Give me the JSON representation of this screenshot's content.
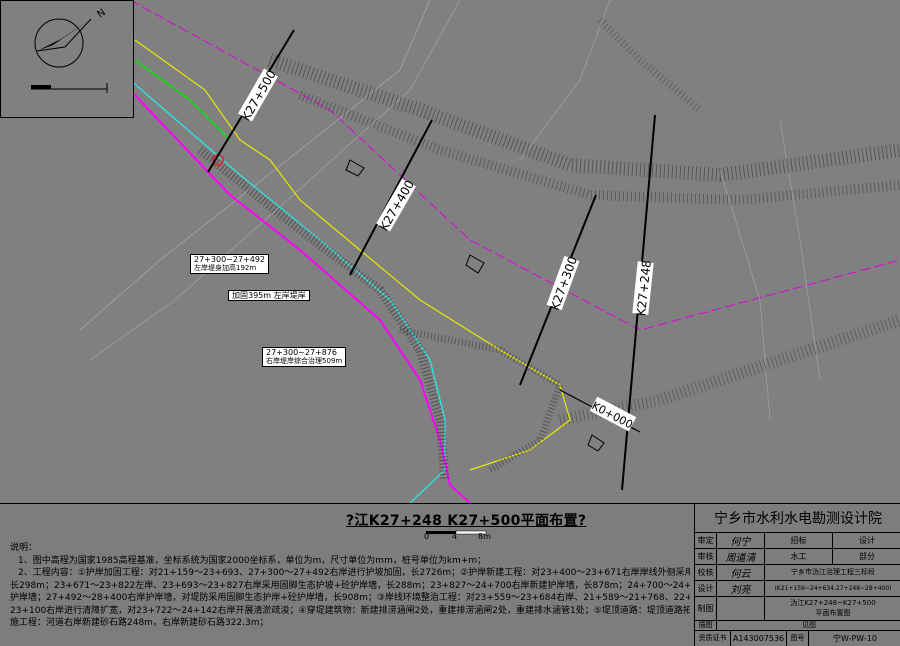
{
  "drawing": {
    "station_labels": [
      "K27+500",
      "K27+400",
      "K27+300",
      "K27+248",
      "K0+000"
    ],
    "callouts": [
      {
        "range": "27+300~27+492",
        "desc": "左岸堤身加高192m"
      },
      {
        "range": "",
        "desc": "加固395m 左岸堤岸"
      },
      {
        "range": "27+300~27+876",
        "desc": "右岸堤岸综合治理509m"
      }
    ]
  },
  "legend": {
    "title": "?江K27+248 K27+500平面布置?",
    "scale_ticks": [
      "0",
      "4",
      "8m"
    ]
  },
  "notes": {
    "heading": "说明：",
    "lines": [
      "1、图中高程为国家1985高程基准，坐标系统为国家2000坐标系，单位为m，尺寸单位为mm，桩号单位为km+m；",
      "2、工程内容：①护岸加固工程：对21+159～23+693、27+300～27+492右岸进行护坡加固，长2726m；②护岸新建工程：对23+400～23+671右岸岸线外侧采用固脚生态护岸+砼护岸墙，",
      "长298m；23+671～23+822左岸、23+693～23+827右岸采用固脚生态护坡+砼护岸墙，长288m；23+827～24+700右岸新建护岸墙，长878m；24+700～24+780右岸新建护岸墙，",
      "护岸墙；27+492～28+400右岸护岸墙，对堤防采用固脚生态护岸+砼护岸墙，长908m；③岸线环境整治工程：对23+559～23+684右岸、21+589～21+768、22+100～22+395、22+700～",
      "23+100右岸进行清障扩宽，对23+722～24+142右岸开展清淤疏浚；④穿堤建筑物：新建排涝涵闸2处，重建排涝涵闸2处，重建排水涵管1处；⑤堤顶道路：堤顶道路拓宽及沥青路面：⑥管理设施",
      "施工程：河道右岸新建砂石路248m，右岸新建砂石路322.3m；"
    ]
  },
  "title_block": {
    "institute": "宁乡市水利水电勘测设计院",
    "rows": [
      {
        "role": "审定",
        "sig": "何宁",
        "label": "招标",
        "value": "设计"
      },
      {
        "role": "审核",
        "sig": "周道清",
        "label": "水工",
        "value": "部分"
      },
      {
        "role": "校核",
        "sig": "何云",
        "label": "宁乡市沩江治理工程三标段",
        "value": ""
      },
      {
        "role": "设计",
        "sig": "刘亮",
        "label": "(K21+159~24+634.27+248~28+400)",
        "value": ""
      },
      {
        "role": "制图",
        "sig": "",
        "label": "沩江K27+248~K27+500",
        "value": "平面布置图"
      },
      {
        "role": "描图",
        "sig": "见图",
        "label": "",
        "value": ""
      }
    ],
    "cert_label": "资质证书",
    "cert_no": "A143007536",
    "drawing_no_label": "图号",
    "drawing_no": "宁W-PW-10"
  }
}
